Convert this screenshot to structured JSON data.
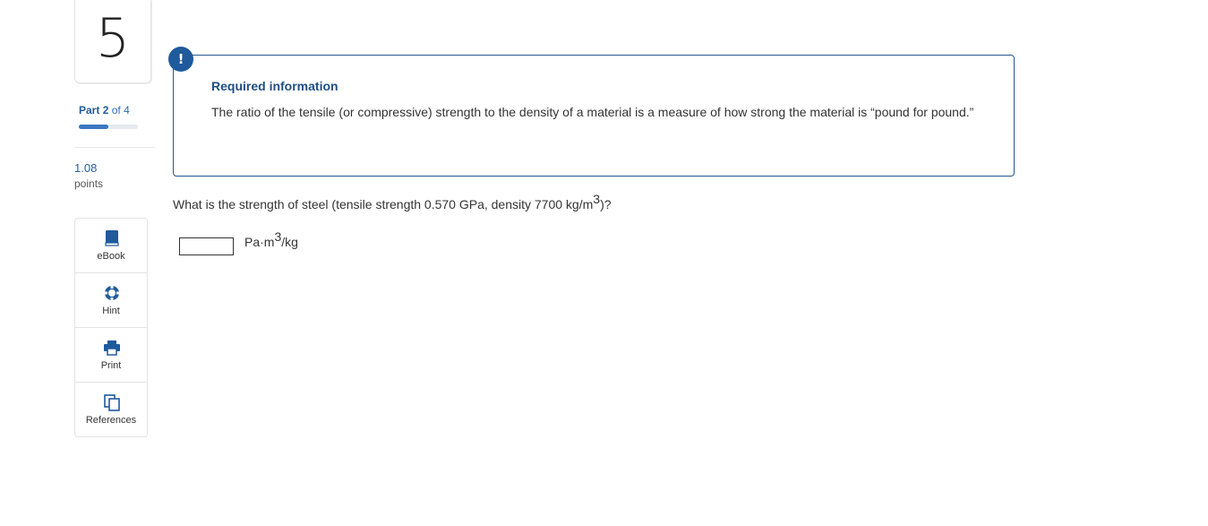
{
  "question_number": "5",
  "part": {
    "word": "Part",
    "current": "2",
    "of_word": "of",
    "total": "4",
    "progress_fraction": 0.5
  },
  "points": {
    "value": "1.08",
    "label": "points"
  },
  "tools": [
    {
      "label": "eBook",
      "icon": "book-icon"
    },
    {
      "label": "Hint",
      "icon": "lifebuoy-icon"
    },
    {
      "label": "Print",
      "icon": "printer-icon"
    },
    {
      "label": "References",
      "icon": "copy-pages-icon"
    }
  ],
  "info": {
    "badge": "!",
    "title": "Required information",
    "text": "The ratio of the tensile (or compressive) strength to the density of a material is a measure of how strong the material is “pound for pound.”"
  },
  "question": {
    "text_before": "What is the strength of steel (tensile strength 0.570 GPa, density 7700 kg/m",
    "sup": "3",
    "text_after": ")?"
  },
  "answer": {
    "value": "",
    "unit_before": "Pa·m",
    "unit_sup": "3",
    "unit_after": "/kg"
  },
  "colors": {
    "accent": "#1f5a9c",
    "progress": "#3a78c2",
    "box_border": "#27568e"
  }
}
